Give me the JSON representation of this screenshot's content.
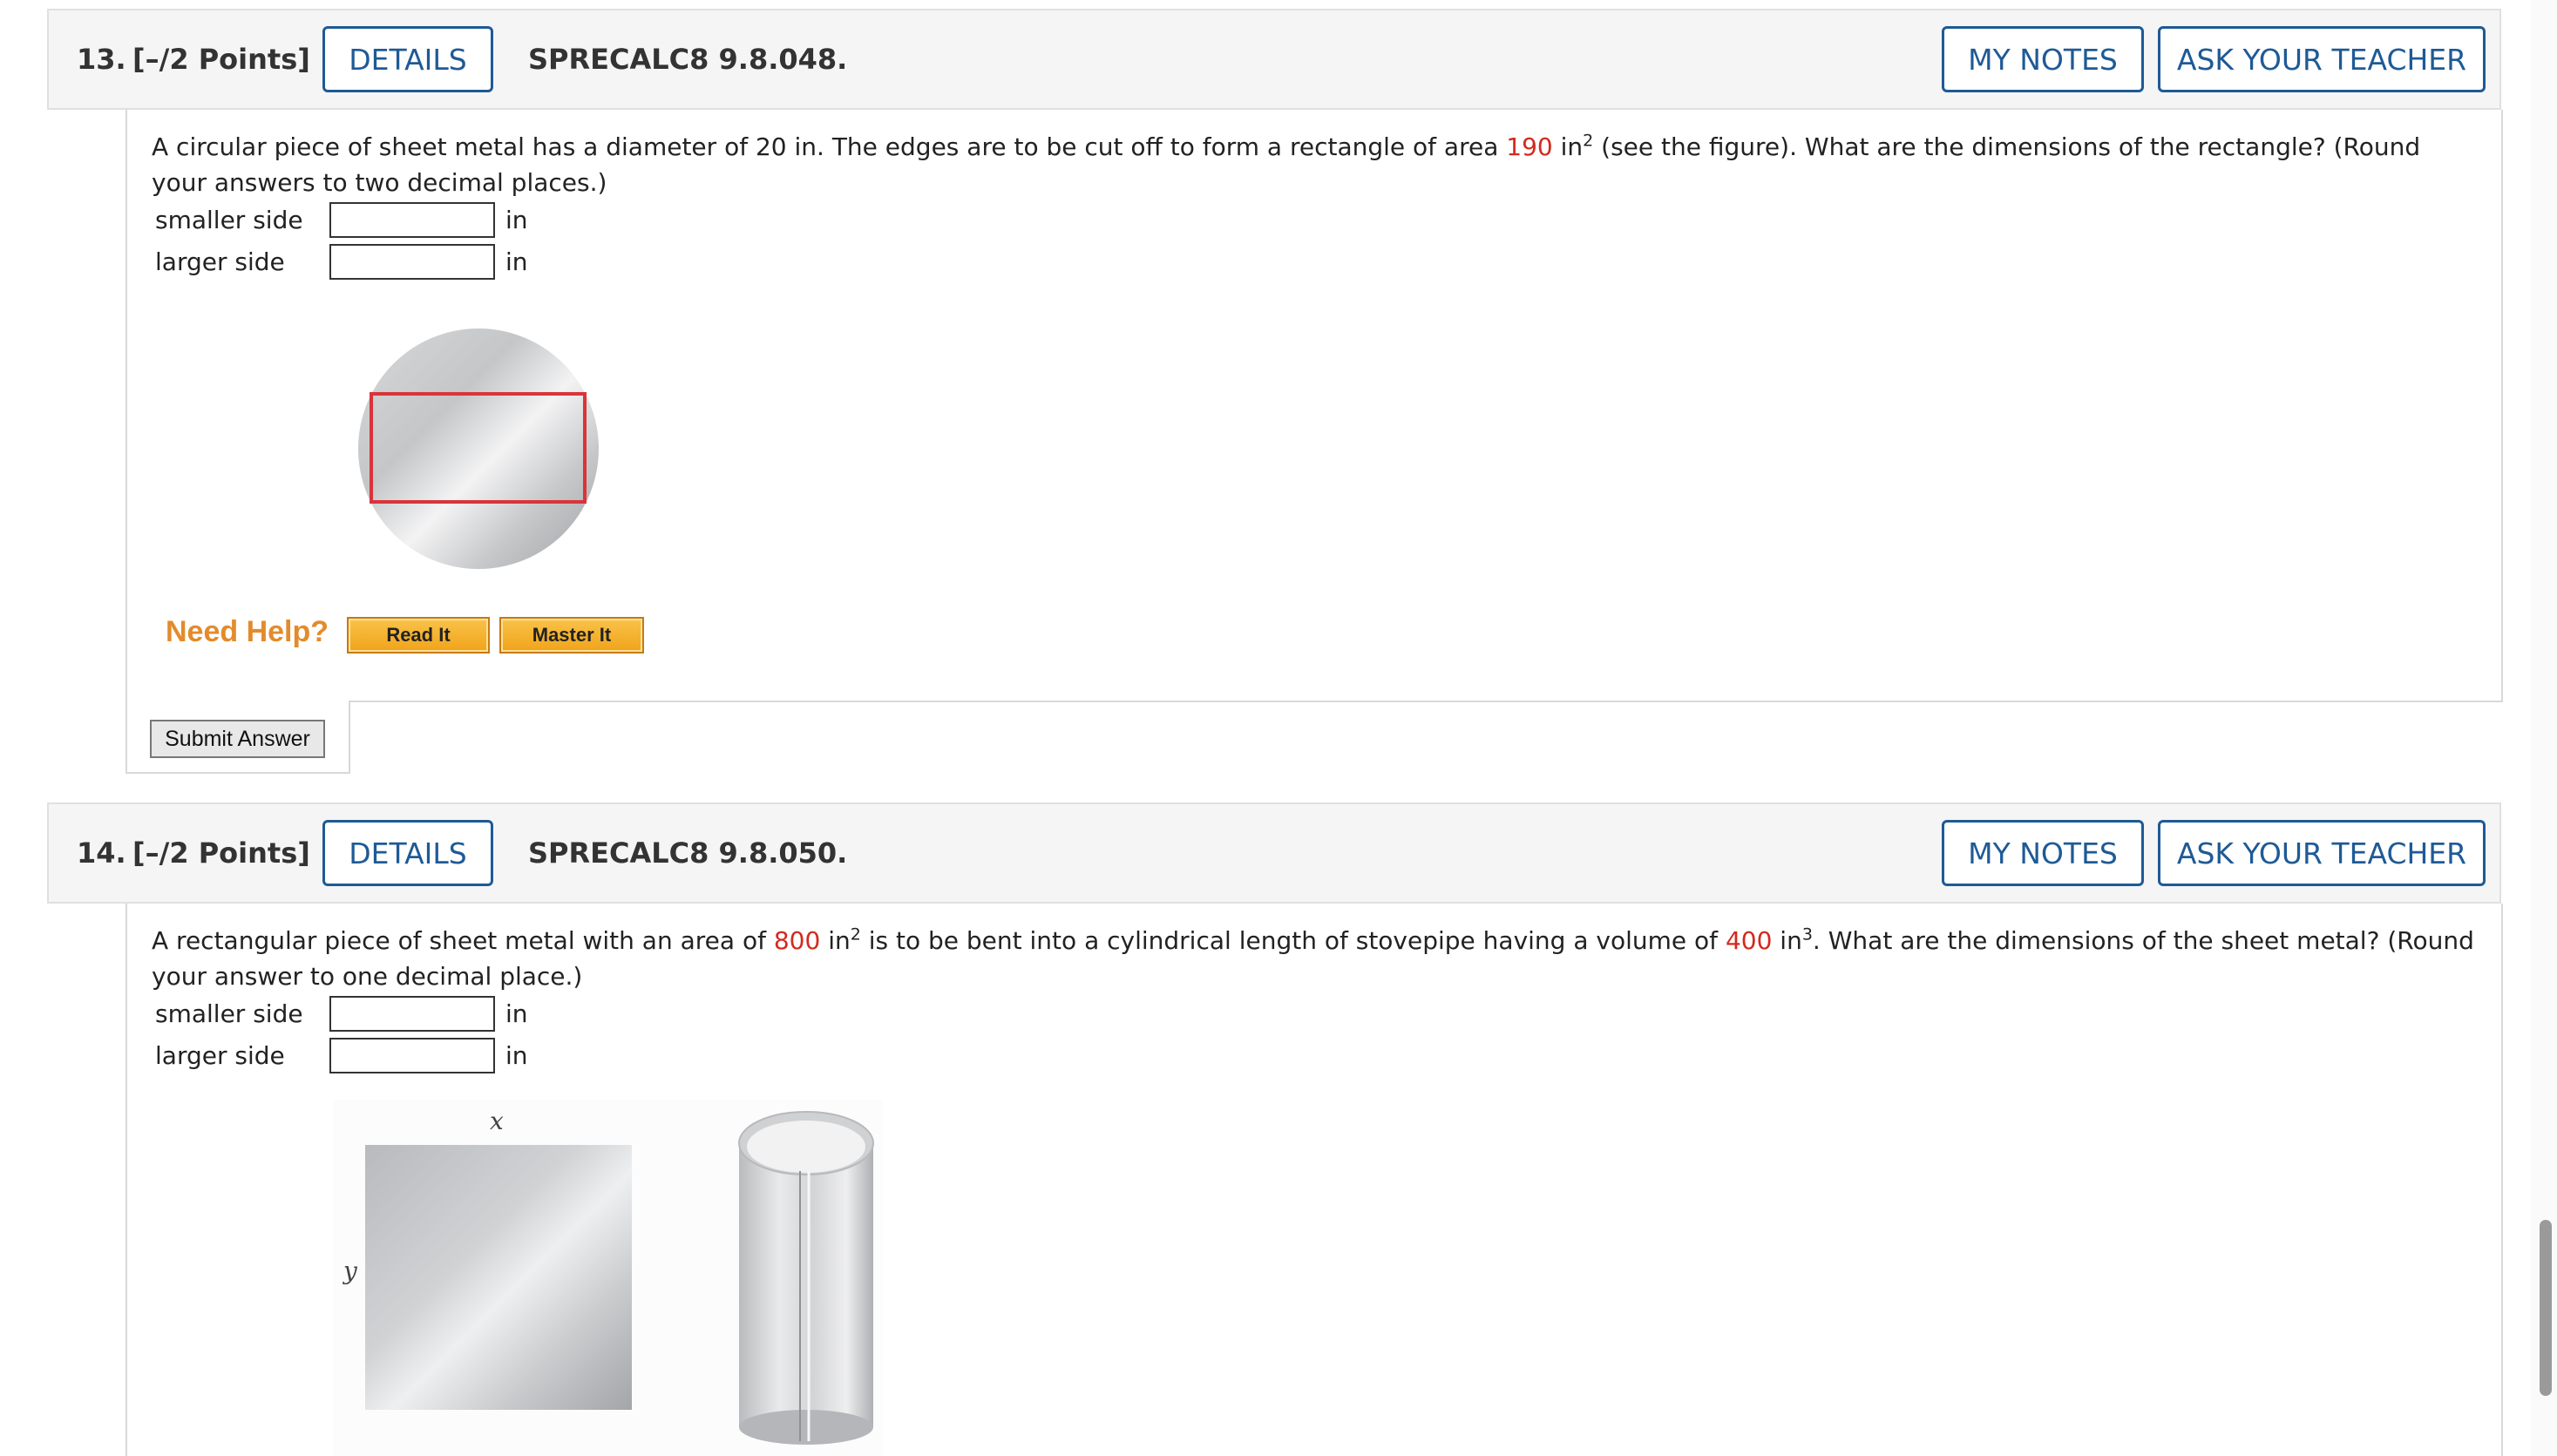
{
  "q13": {
    "number": "13.",
    "points": "[–/2 Points]",
    "details": "DETAILS",
    "code": "SPRECALC8 9.8.048.",
    "my_notes": "MY NOTES",
    "ask_teacher": "ASK YOUR TEACHER",
    "text_1": "A circular piece of sheet metal has a diameter of 20 in. The edges are to be cut off to form a rectangle of area ",
    "area_value": "190",
    "area_unit": " in",
    "area_exp": "2",
    "text_2": " (see the figure). What are the dimensions of the rectangle? (Round your answers to two decimal places.)",
    "smaller_label": "smaller side",
    "larger_label": "larger side",
    "unit": "in",
    "need_help": "Need Help?",
    "read_it": "Read It",
    "master_it": "Master It",
    "submit": "Submit Answer"
  },
  "q14": {
    "number": "14.",
    "points": "[–/2 Points]",
    "details": "DETAILS",
    "code": "SPRECALC8 9.8.050.",
    "my_notes": "MY NOTES",
    "ask_teacher": "ASK YOUR TEACHER",
    "text_1": "A rectangular piece of sheet metal with an area of ",
    "area_value": "800",
    "area_unit": " in",
    "area_exp": "2",
    "text_2": " is to be bent into a cylindrical length of stovepipe having a volume of ",
    "volume_value": "400",
    "volume_unit": " in",
    "volume_exp": "3",
    "text_3": ". What are the dimensions of the sheet metal? (Round your answer to one decimal place.)",
    "smaller_label": "smaller side",
    "larger_label": "larger side",
    "unit": "in",
    "fig_x": "x",
    "fig_y": "y"
  },
  "colors": {
    "accent": "#1e5a96",
    "value_red": "#d32a1e",
    "help_orange": "#e38b2c",
    "rect_outline": "#d8353a"
  }
}
